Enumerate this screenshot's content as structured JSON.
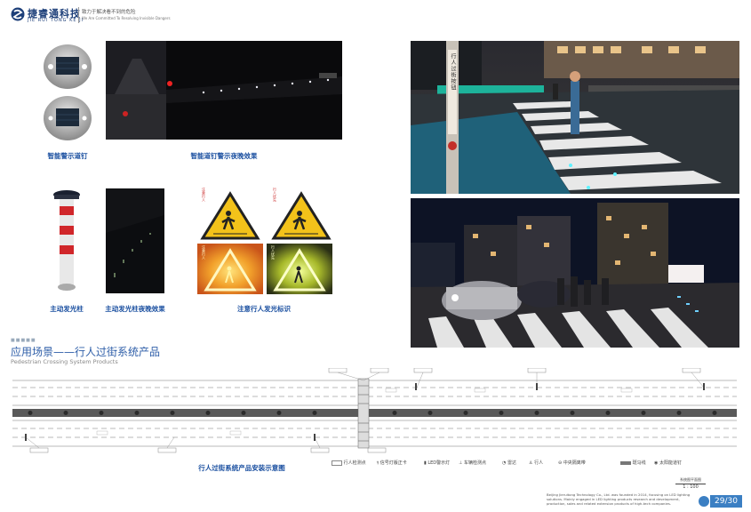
{
  "header": {
    "brand_cn": "捷睿通科技",
    "brand_en": "JIE RUI TONG KE JI",
    "slogan_cn": "致力于解决看不到的危险",
    "slogan_en": "We Are Committed To Resolving Invisible Dangers"
  },
  "captions": {
    "road_stud": "智能警示道钉",
    "road_stud_night": "智能道钉警示夜晚效果",
    "active_post": "主动发光柱",
    "active_post_night": "主动发光柱夜晚效果",
    "ped_sign": "注意行人发光标识"
  },
  "sign_texts": {
    "sign1": "注意行人",
    "sign2": "行人优先",
    "sign3": "注意行人",
    "sign4": "行人优先"
  },
  "pole_sign": "行人过街按钮",
  "section": {
    "title": "应用场景——行人过街系统产品",
    "subtitle": "Pedestrian Crossing System Products",
    "dots": "■■■■■"
  },
  "diagram": {
    "caption": "行人过街系统产品安装示意图",
    "legend": [
      "行人检测点",
      "信号灯版正卡",
      "LED警示灯",
      "车辆检测点",
      "雷达",
      "行人",
      "中央隔离带",
      "斑马线",
      "太阳能道钉"
    ]
  },
  "scale": {
    "label": "系统图平面图",
    "ratio": "1 : 100"
  },
  "footer": {
    "text": "Beijing Jieruitong Technology Co., Ltd. was founded in 2014, focusing on LED lighting solutions. Mainly engaged in LED lighting products research and development, production, sales and related extension products of high-tech companies.",
    "page": "29/30"
  }
}
